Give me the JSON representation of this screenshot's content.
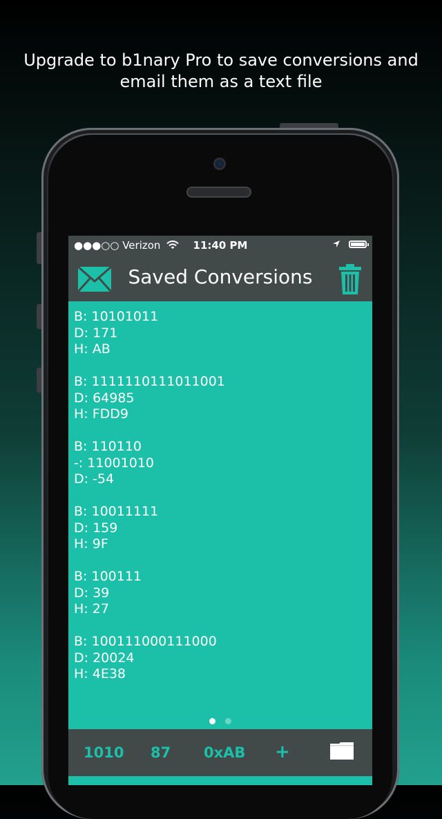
{
  "promo": {
    "line1": "Upgrade to b1nary Pro to save conversions and",
    "line2": "email them as a text file"
  },
  "statusbar": {
    "carrier": "●●●○○ Verizon",
    "time": "11:40 PM",
    "icons": [
      "wifi-icon",
      "location-arrow-icon",
      "battery-icon"
    ]
  },
  "navbar": {
    "title": "Saved Conversions",
    "left_icon": "mail-icon",
    "right_icon": "trash-icon"
  },
  "entries": [
    {
      "l1": "B: 10101011",
      "l2": "D: 171",
      "l3": "H: AB"
    },
    {
      "l1": "B: 1111110111011001",
      "l2": "D: 64985",
      "l3": "H: FDD9"
    },
    {
      "l1": "B: 110110",
      "l2": "-: 11001010",
      "l3": "D: -54"
    },
    {
      "l1": "B: 10011111",
      "l2": "D: 159",
      "l3": "H: 9F"
    },
    {
      "l1": "B: 100111",
      "l2": "D: 39",
      "l3": "H: 27"
    },
    {
      "l1": "B: 100111000111000",
      "l2": "D: 20024",
      "l3": "H: 4E38"
    }
  ],
  "page_indicator": {
    "count": 2,
    "active": 1
  },
  "tabbar": {
    "binary": "1010",
    "decimal": "87",
    "hex": "0xAB",
    "add": "+",
    "folder_icon": "folder-icon"
  },
  "colors": {
    "accent": "#1cc0a9",
    "bar": "#424949"
  }
}
